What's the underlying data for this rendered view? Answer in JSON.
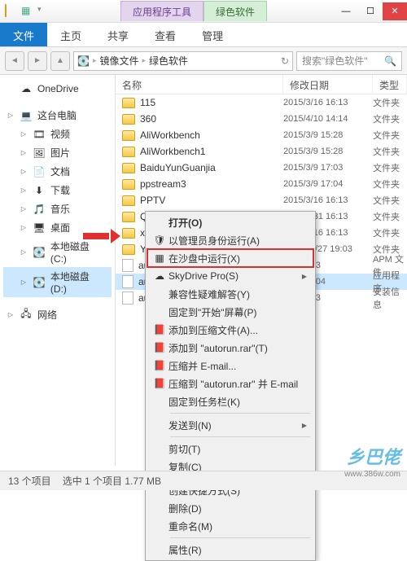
{
  "title_tabs": {
    "purple": "应用程序工具",
    "green": "绿色软件"
  },
  "ribbon": {
    "file": "文件",
    "tabs": [
      "主页",
      "共享",
      "查看",
      "管理"
    ]
  },
  "breadcrumb": [
    "镜像文件",
    "绿色软件"
  ],
  "search_placeholder": "搜索\"绿色软件\"",
  "sidebar": {
    "items": [
      {
        "label": "OneDrive",
        "icon": "cloud",
        "indent": 0,
        "exp": ""
      },
      {
        "label": "这台电脑",
        "icon": "pc",
        "indent": 0,
        "exp": "▷"
      },
      {
        "label": "视频",
        "icon": "video",
        "indent": 1,
        "exp": "▷"
      },
      {
        "label": "图片",
        "icon": "pic",
        "indent": 1,
        "exp": "▷"
      },
      {
        "label": "文档",
        "icon": "doc",
        "indent": 1,
        "exp": "▷"
      },
      {
        "label": "下载",
        "icon": "dl",
        "indent": 1,
        "exp": "▷"
      },
      {
        "label": "音乐",
        "icon": "music",
        "indent": 1,
        "exp": "▷"
      },
      {
        "label": "桌面",
        "icon": "desk",
        "indent": 1,
        "exp": "▷"
      },
      {
        "label": "本地磁盘 (C:)",
        "icon": "disk",
        "indent": 1,
        "exp": "▷"
      },
      {
        "label": "本地磁盘 (D:)",
        "icon": "disk",
        "indent": 1,
        "exp": "▷",
        "hl": true
      },
      {
        "label": "网络",
        "icon": "net",
        "indent": 0,
        "exp": "▷"
      }
    ]
  },
  "columns": {
    "name": "名称",
    "date": "修改日期",
    "type": "类型"
  },
  "files": [
    {
      "name": "115",
      "date": "2015/3/16 16:13",
      "type": "文件夹",
      "icon": "folder"
    },
    {
      "name": "360",
      "date": "2015/4/10 14:14",
      "type": "文件夹",
      "icon": "folder"
    },
    {
      "name": "AliWorkbench",
      "date": "2015/3/9 15:28",
      "type": "文件夹",
      "icon": "folder"
    },
    {
      "name": "AliWorkbench1",
      "date": "2015/3/9 15:28",
      "type": "文件夹",
      "icon": "folder"
    },
    {
      "name": "BaiduYunGuanjia",
      "date": "2015/3/9 17:03",
      "type": "文件夹",
      "icon": "folder"
    },
    {
      "name": "ppstream3",
      "date": "2015/3/9 17:04",
      "type": "文件夹",
      "icon": "folder"
    },
    {
      "name": "PPTV",
      "date": "2015/3/16 16:13",
      "type": "文件夹",
      "icon": "folder"
    },
    {
      "name": "QQ2014",
      "date": "2015/3/31 16:13",
      "type": "文件夹",
      "icon": "folder"
    },
    {
      "name": "xunlei",
      "date": "2015/3/16 16:13",
      "type": "文件夹",
      "icon": "folder"
    },
    {
      "name": "YouKu",
      "date": "2011/12/27 19:03",
      "type": "文件夹",
      "icon": "folder"
    },
    {
      "name": "auto",
      "date": "4/16 0:23",
      "type": "APM 文件",
      "icon": "file"
    },
    {
      "name": "aut",
      "date": "7/22 22:04",
      "type": "应用程序",
      "icon": "file",
      "sel": true
    },
    {
      "name": "auto",
      "date": "4/16 0:23",
      "type": "安装信息",
      "icon": "file"
    }
  ],
  "context_menu": [
    {
      "label": "打开(O)",
      "bold": true
    },
    {
      "label": "以管理员身份运行(A)",
      "icon": "shield"
    },
    {
      "label": "在沙盘中运行(X)",
      "icon": "sandbox",
      "boxed": true
    },
    {
      "label": "SkyDrive Pro(S)",
      "icon": "cloud",
      "sub": true
    },
    {
      "label": "兼容性疑难解答(Y)"
    },
    {
      "label": "固定到\"开始\"屏幕(P)"
    },
    {
      "label": "添加到压缩文件(A)...",
      "icon": "rar"
    },
    {
      "label": "添加到 \"autorun.rar\"(T)",
      "icon": "rar"
    },
    {
      "label": "压缩并 E-mail...",
      "icon": "rar"
    },
    {
      "label": "压缩到 \"autorun.rar\" 并 E-mail",
      "icon": "rar"
    },
    {
      "label": "固定到任务栏(K)"
    },
    {
      "sep": true
    },
    {
      "label": "发送到(N)",
      "sub": true
    },
    {
      "sep": true
    },
    {
      "label": "剪切(T)"
    },
    {
      "label": "复制(C)"
    },
    {
      "sep": true
    },
    {
      "label": "创建快捷方式(S)"
    },
    {
      "label": "删除(D)"
    },
    {
      "label": "重命名(M)"
    },
    {
      "sep": true
    },
    {
      "label": "属性(R)"
    }
  ],
  "status": {
    "count": "13 个项目",
    "selected": "选中 1 个项目 1.77 MB"
  },
  "watermark": "乡巴佬",
  "watermark_url": "www.386w.com"
}
